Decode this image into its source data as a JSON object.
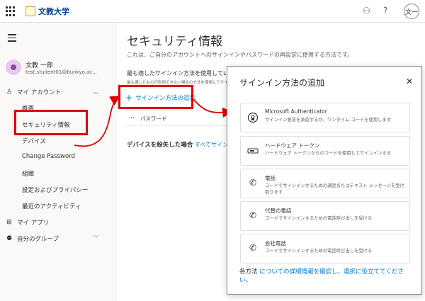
{
  "app": {
    "logo_text": "文教大学",
    "user_initials": "文一"
  },
  "nav": {
    "user_name": "文教 一郎",
    "user_email": "test.student01@bunkyo.ac...",
    "my_account": "マイ アカウント",
    "items": [
      "概要",
      "セキュリティ情報",
      "デバイス",
      "Change Password",
      "組織",
      "設定およびプライバシー",
      "最近のアクティビティ"
    ],
    "my_apps": "マイ アプリ",
    "my_groups": "自分のグループ"
  },
  "main": {
    "title": "セキュリティ情報",
    "description": "これは、ご自分のアカウントへのサインインやパスワードの再設定に使用する方法です。",
    "best_method": "最も適したサインイン方法を使用しています。",
    "best_method_sub": "最も適したものが利用できない場合の方法を使用してサインイン方法:",
    "add_method": "サインイン方法の追加",
    "password_label": "パスワード",
    "lost_device": "デバイスを紛失した場合",
    "sign_out_all": "すべてサインアウトし"
  },
  "dialog": {
    "title": "サインイン方法の追加",
    "options": [
      {
        "title": "Microsoft Authenticator",
        "desc": "サインイン要求を承認するか、ワンタイム コードを使用します",
        "icon": "authenticator-icon"
      },
      {
        "title": "ハードウェア トークン",
        "desc": "ハードウェア トークンからのコードを使用してサインインする",
        "icon": "hardware-token-icon"
      },
      {
        "title": "電話",
        "desc": "コードでサインインするための通話またはテキスト メッセージを受け取ります",
        "icon": "phone-icon"
      },
      {
        "title": "代替の電話",
        "desc": "コードでサインインするための電話呼び出しを受ける",
        "icon": "phone-icon"
      },
      {
        "title": "会社電話",
        "desc": "コードでサインインするための電話呼び出しを受ける",
        "icon": "phone-icon"
      }
    ],
    "footer_prefix": "各方法",
    "footer_link": "についての詳細情報を確認し、選択に役立ててください。"
  },
  "colors": {
    "highlight": "#e00000",
    "link": "#0078d4"
  }
}
